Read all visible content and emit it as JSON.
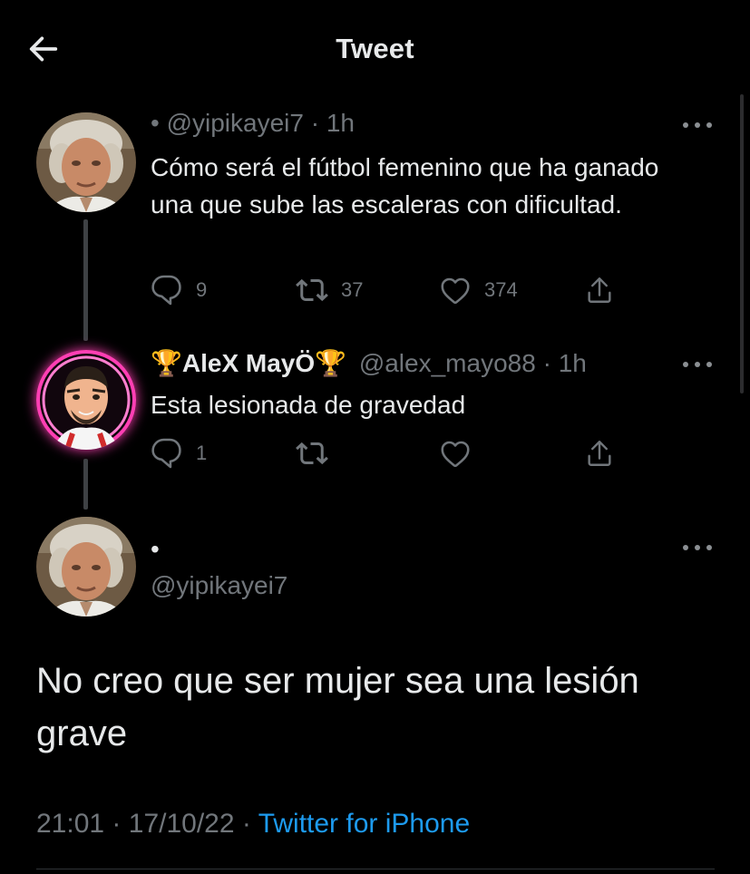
{
  "header": {
    "title": "Tweet"
  },
  "tweets": [
    {
      "dot": "•",
      "handle": "@yipikayei7",
      "separator": "·",
      "time": "1h",
      "text": "Cómo será el fútbol femenino que ha ganado una que sube las escaleras con dificultad.",
      "replies": "9",
      "retweets": "37",
      "likes": "374"
    },
    {
      "trophy_left": "🏆",
      "name": "AleX MayÖ",
      "trophy_right": "🏆",
      "handle": "@alex_mayo88",
      "separator": "·",
      "time": "1h",
      "text": "Esta lesionada de gravedad",
      "replies": "1"
    }
  ],
  "main_tweet": {
    "dot": "•",
    "handle": "@yipikayei7",
    "text": "No creo que ser mujer sea una lesión grave",
    "time": "21:01",
    "date": "17/10/22",
    "separator": "·",
    "source": "Twitter for iPhone"
  },
  "colors": {
    "background": "#000000",
    "text": "#e7e9ea",
    "secondary": "#71767b",
    "link": "#1d9bf0",
    "thread_line": "#3e4144",
    "neon_ring": "#ff3fb4"
  },
  "icons": [
    "back-arrow-icon",
    "more-icon",
    "reply-icon",
    "retweet-icon",
    "like-icon",
    "share-icon",
    "trophy-icon"
  ]
}
